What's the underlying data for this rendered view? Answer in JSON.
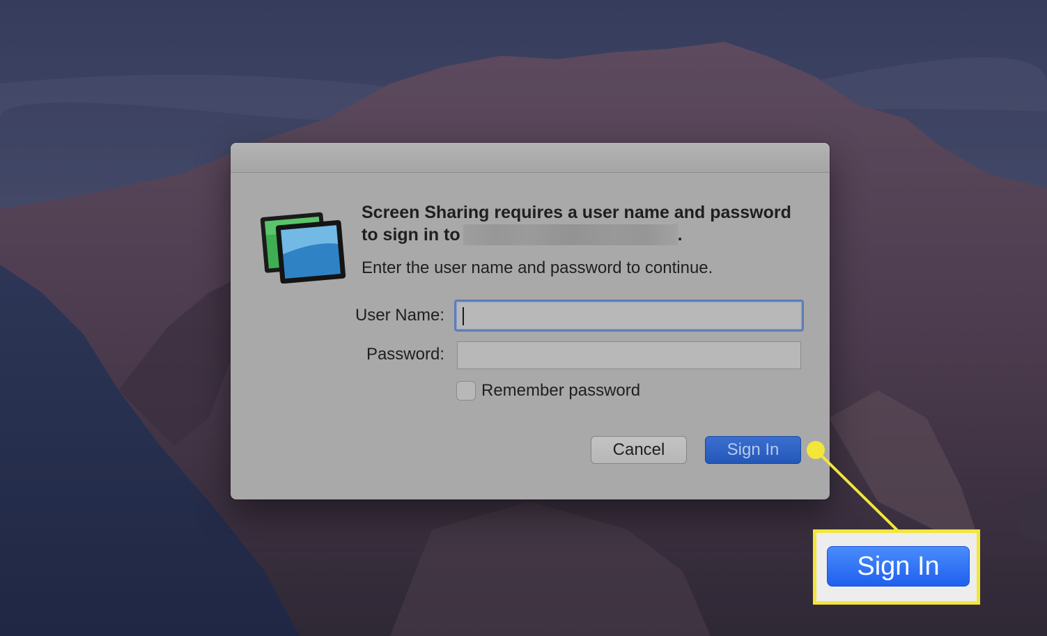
{
  "dialog": {
    "app_icon": "screen-sharing-icon",
    "headline": "Screen Sharing requires a user name and password to sign in to",
    "headline_suffix": ".",
    "subtext": "Enter the user name and password to continue.",
    "username_label": "User Name:",
    "username_value": "",
    "password_label": "Password:",
    "password_value": "",
    "remember_label": "Remember password",
    "remember_checked": false,
    "cancel_label": "Cancel",
    "signin_label": "Sign In"
  },
  "callout": {
    "button_label": "Sign In",
    "highlight_color": "#f3e63a"
  },
  "colors": {
    "accent": "#2457b8",
    "focus_ring": "#5f7eb8"
  }
}
